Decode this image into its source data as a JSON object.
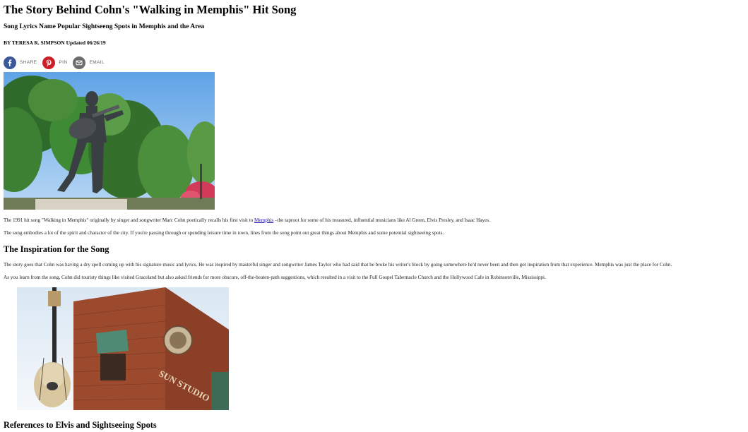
{
  "article": {
    "title": "The Story Behind Cohn's \"Walking in Memphis\" Hit Song",
    "subtitle": "Song Lyrics Name Popular Sightseeng Spots in Memphis and the Area",
    "byline": "BY TERESA R. SIMPSON Updated 06/26/19"
  },
  "share": {
    "items": [
      {
        "label": "SHARE",
        "icon": "facebook-icon",
        "color": "#3b5998"
      },
      {
        "label": "PIN",
        "icon": "pinterest-icon",
        "color": "#cb2027"
      },
      {
        "label": "EMAIL",
        "icon": "email-icon",
        "color": "#6d6d6d"
      }
    ]
  },
  "body": {
    "p1_before": "The 1991 hit song \"Walking in Memphis\" originally by singer and songwriter Marc Cohn poetically recalls his first visit to ",
    "p1_link": "Memphis",
    "p1_after": " –the taproot for some of his treasured, influential musicians like Al Green, Elvis Presley, and Isaac Hayes.",
    "p2": "The song embodies a lot of the spirit and character of the city. If you're passing through or spending leisure time in town, lines from the song point out great things about Memphis and some potential sightseeing spots.",
    "h2a": "The Inspiration for the Song",
    "p3": "The story goes that Cohn was having a dry spell coming up with his signature music and lyrics. He was inspired by masterful singer and songwriter James Taylor who had said that he broke his writer's block by going somewhere he'd never been and then got inspiration from that experience. Memphis was just the place for Cohn.",
    "p4": "As you learn from the song, Cohn did touristy things like visited Graceland but also asked friends for more obscure, off-the-beaten-path suggestions, which resulted in a visit to the Full Gospel Tabernacle Church and the Hollywood Cafe in Robinsonville, Mississippi.",
    "h2b": "References to Elvis and Sightseeing Spots"
  },
  "photo2": {
    "sign_text": "SUN STUDIO"
  },
  "colors": {
    "link": "#1a0dab",
    "sky": "#7fb5e8",
    "brick": "#9b4a2e"
  }
}
